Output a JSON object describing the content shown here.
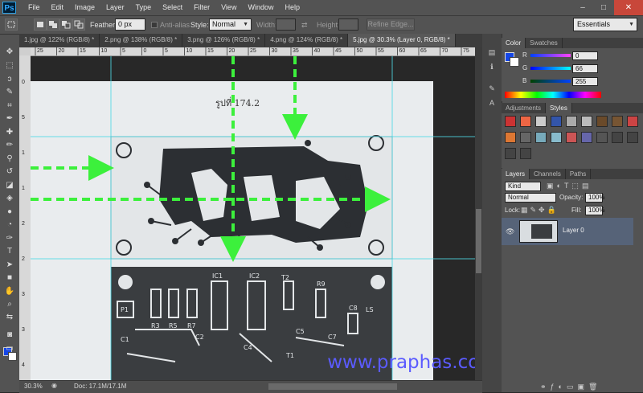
{
  "app": {
    "logo": "Ps"
  },
  "menu": [
    "File",
    "Edit",
    "Image",
    "Layer",
    "Type",
    "Select",
    "Filter",
    "View",
    "Window",
    "Help"
  ],
  "window_controls": {
    "minimize": "–",
    "maximize": "□",
    "close": "✕"
  },
  "options": {
    "feather_label": "Feather:",
    "feather_value": "0 px",
    "antialias_label": "Anti-alias",
    "style_label": "Style:",
    "style_value": "Normal",
    "width_label": "Width:",
    "height_label": "Height:",
    "refine_label": "Refine Edge...",
    "workspace": "Essentials"
  },
  "tabs": [
    {
      "label": "1.jpg @ 122% (RGB/8) *",
      "active": false
    },
    {
      "label": "2.png @ 138% (RGB/8) *",
      "active": false
    },
    {
      "label": "3.png @ 126% (RGB/8) *",
      "active": false
    },
    {
      "label": "4.png @ 124% (RGB/8) *",
      "active": false
    },
    {
      "label": "5.jpg @ 30.3% (Layer 0, RGB/8) *",
      "active": true
    }
  ],
  "ruler_top_labels": [
    "25",
    "20",
    "15",
    "10",
    "5",
    "0",
    "5",
    "10",
    "15",
    "20",
    "25",
    "30",
    "35",
    "40",
    "45",
    "50",
    "55",
    "60",
    "65",
    "70",
    "75"
  ],
  "ruler_left_labels": [
    "0",
    "5",
    "1",
    "1",
    "2",
    "2",
    "3",
    "3",
    "4"
  ],
  "document": {
    "page_heading": "รูปที่ 174.2",
    "pcb_labels": [
      "P1",
      "R3",
      "R5",
      "R7",
      "IC1",
      "IC2",
      "T2",
      "R9",
      "C1",
      "C2",
      "C4",
      "C5",
      "C7",
      "C8",
      "T1",
      "LS"
    ],
    "watermark": "www.praphas.com"
  },
  "status": {
    "zoom": "30.3%",
    "doc": "Doc: 17.1M/17.1M"
  },
  "color_panel": {
    "tabs": [
      {
        "label": "Color",
        "active": true
      },
      {
        "label": "Swatches",
        "active": false
      }
    ],
    "r_label": "R",
    "g_label": "G",
    "b_label": "B",
    "r": "0",
    "g": "66",
    "b": "255"
  },
  "styles_panel": {
    "tabs": [
      {
        "label": "Adjustments",
        "active": false
      },
      {
        "label": "Styles",
        "active": true
      }
    ]
  },
  "layers_panel": {
    "tabs": [
      {
        "label": "Layers",
        "active": true
      },
      {
        "label": "Channels",
        "active": false
      },
      {
        "label": "Paths",
        "active": false
      }
    ],
    "kind": "Kind",
    "blend_mode": "Normal",
    "opacity_label": "Opacity:",
    "opacity": "100%",
    "lock_label": "Lock:",
    "fill_label": "Fill:",
    "fill": "100%",
    "layer_name": "Layer 0"
  },
  "colors": {
    "accent": "#3cf03c",
    "fg": "#1546e6",
    "watermark": "#5b5bff"
  }
}
